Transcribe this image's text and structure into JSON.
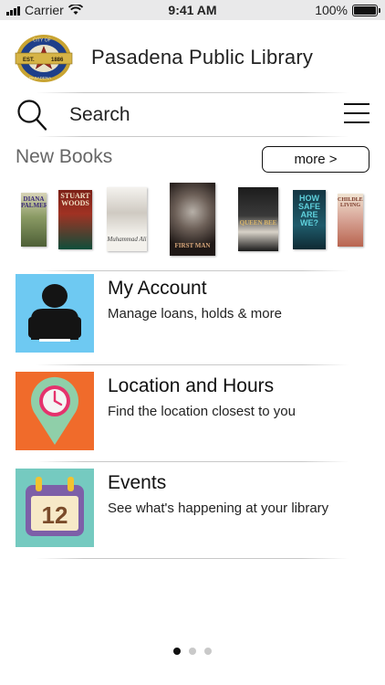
{
  "status_bar": {
    "carrier": "Carrier",
    "time": "9:41 AM",
    "battery": "100%"
  },
  "header": {
    "title": "Pasadena Public Library",
    "seal_text_top": "CITY OF",
    "seal_text_est": "EST.",
    "seal_text_year": "1886",
    "seal_text_bottom": "PASADENA"
  },
  "search": {
    "label": "Search"
  },
  "new_books": {
    "title": "New Books",
    "more_label": "more >",
    "books": [
      {
        "text": "DIANA PALMER",
        "color": "#6b7a4e"
      },
      {
        "text": "STUART WOODS",
        "color": "#8a2a1e"
      },
      {
        "text": "Muhammad Ali",
        "color": "#e9e6e1"
      },
      {
        "text": "FIRST MAN",
        "color": "#2a2320"
      },
      {
        "text": "QUEEN BEE",
        "color": "#222222"
      },
      {
        "text": "HOW SAFE ARE WE?",
        "color": "#1f5060"
      },
      {
        "text": "CHILDLESS LIVING",
        "color": "#c98a7c"
      }
    ]
  },
  "menu": [
    {
      "title": "My Account",
      "subtitle": "Manage loans, holds & more",
      "tile_color": "#6ec9f2"
    },
    {
      "title": "Location and Hours",
      "subtitle": "Find the location closest to you",
      "tile_color": "#f06b2b"
    },
    {
      "title": "Events",
      "subtitle": "See what's happening at your library",
      "tile_color": "#75cac0",
      "calendar_day": "12"
    }
  ],
  "pager": {
    "pages": 3,
    "active": 1
  }
}
